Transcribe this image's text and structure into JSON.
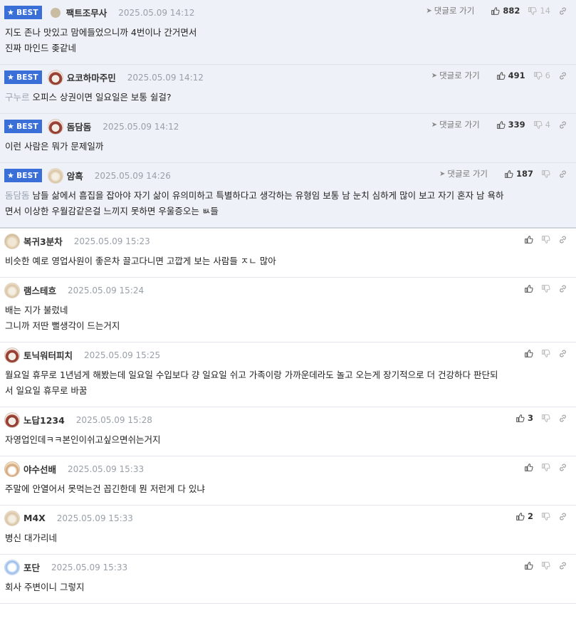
{
  "labels": {
    "best": "BEST",
    "reply": "댓글로 가기"
  },
  "comments": [
    {
      "best": true,
      "avatar": "dot",
      "nick": "팩트조무사",
      "date": "2025.05.09 14:12",
      "up": "882",
      "down": "14",
      "mention": "",
      "lines": [
        "지도 존나 맛있고 맘에들었으니까 4번이나 간거면서",
        "진짜 마인드 좆같네"
      ]
    },
    {
      "best": true,
      "avatar": "bear",
      "nick": "요코하마주민",
      "date": "2025.05.09 14:12",
      "up": "491",
      "down": "6",
      "mention": "구누르",
      "lines": [
        "오피스 상권이면 일요일은 보통 쉴걸?"
      ]
    },
    {
      "best": true,
      "avatar": "bear",
      "nick": "돔담돔",
      "date": "2025.05.09 14:12",
      "up": "339",
      "down": "4",
      "mention": "",
      "lines": [
        "이런 사람은 뭐가 문제일까"
      ]
    },
    {
      "best": true,
      "avatar": "puppy",
      "nick": "암흑",
      "date": "2025.05.09 14:26",
      "up": "187",
      "down": "",
      "mention": "돔담돔",
      "lines": [
        "남들 삶에서 흠집을 잡아야 자기 삶이 유의미하고 특별하다고 생각하는 유형임 보통 남 눈치 심하게 많이 보고 자기 혼자 남 욕하",
        "면서 이상한 우월감같은걸 느끼지 못하면 우울증오는 ㅄ들"
      ]
    },
    {
      "best": false,
      "avatar": "hamster",
      "nick": "복귀3분차",
      "date": "2025.05.09 15:23",
      "up": "",
      "down": "",
      "mention": "",
      "lines": [
        "비슷한 예로 영업사원이 좋은차 끌고다니면 고깝게 보는 사람들 ㅈㄴ 많아"
      ]
    },
    {
      "best": false,
      "avatar": "puppy",
      "nick": "램스테흐",
      "date": "2025.05.09 15:24",
      "up": "",
      "down": "",
      "mention": "",
      "lines": [
        "배는 지가 불렀네",
        "그니까 저딴 뻘생각이 드는거지"
      ]
    },
    {
      "best": false,
      "avatar": "bear",
      "nick": "토닉워터피치",
      "date": "2025.05.09 15:25",
      "up": "",
      "down": "",
      "mention": "",
      "lines": [
        "월요일 휴무로 1년넘게 해봤는데 일요일 수입보다 걍 일요일 쉬고 가족이랑 가까운데라도 놀고 오는게 장기적으로 더 건강하다 판단되",
        "서 일요일 휴무로 바꿈"
      ]
    },
    {
      "best": false,
      "avatar": "bear",
      "nick": "노답1234",
      "date": "2025.05.09 15:28",
      "up": "3",
      "down": "",
      "mention": "",
      "lines": [
        "자영업인데ㅋㅋ본인이쉬고싶으면쉬는거지"
      ]
    },
    {
      "best": false,
      "avatar": "cat",
      "nick": "야수선배",
      "date": "2025.05.09 15:33",
      "up": "",
      "down": "",
      "mention": "",
      "lines": [
        "주말에 안열어서 못먹는건 꼽긴한데 뭔 저런게 다 있냐"
      ]
    },
    {
      "best": false,
      "avatar": "puppy",
      "nick": "M4X",
      "date": "2025.05.09 15:33",
      "up": "2",
      "down": "",
      "mention": "",
      "lines": [
        "병신 대가리네"
      ]
    },
    {
      "best": false,
      "avatar": "blue",
      "nick": "포단",
      "date": "2025.05.09 15:33",
      "up": "",
      "down": "",
      "mention": "",
      "lines": [
        "회사 주변이니 그렇지"
      ]
    }
  ]
}
